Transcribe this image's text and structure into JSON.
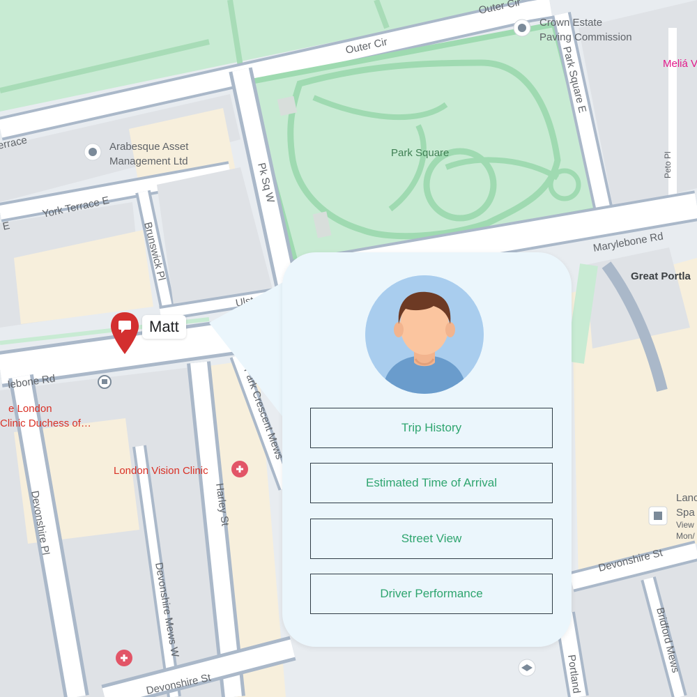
{
  "map": {
    "streets": {
      "outer_cir_top": "Outer Cir",
      "outer_cir": "Outer Cir",
      "terrace_partial": "errace",
      "york_terrace_e": "York Terrace E",
      "e_partial": "E",
      "pk_sq_w": "Pk Sq W",
      "park_square_e": "Park Square E",
      "peto_pl": "Peto Pl",
      "marylebone_rd_right": "Marylebone Rd",
      "marylebone_rd_left": "lebone Rd",
      "brunswick_pl": "Brunswick Pl",
      "ulster_pl": "Ulster Pl",
      "park_crescent_mews": "Park Crescent Mews",
      "harley_st": "Harley St",
      "devonshire_pl": "Devonshire Pl",
      "devonshire_mews_w": "Devonshire Mews W",
      "devonshire_st_bottom": "Devonshire St",
      "devonshire_st_right": "Devonshire St",
      "bridford_mews": "Bridford Mews",
      "portland_partial": "Portland"
    },
    "places": {
      "crown_estate_line1": "Crown Estate",
      "crown_estate_line2": "Paving Commission",
      "arabesque_line1": "Arabesque Asset",
      "arabesque_line2": "Management Ltd",
      "park_square": "Park Square",
      "melia_partial": "Meliá V",
      "great_portland_partial": "Great Portla",
      "london_clinic_line1": "e London",
      "london_clinic_line2": "Clinic Duchess of…",
      "london_vision_clinic": "London Vision Clinic",
      "land_partial": "Lanc",
      "spa_partial": "Spa",
      "view_partial": "View",
      "mon_partial": "Mon/"
    },
    "colors": {
      "park": "#c8ebd3",
      "road": "#aab8c9",
      "building": "#dde1e6",
      "landuse": "#f8f1e3"
    }
  },
  "marker": {
    "label": "Matt",
    "icon": "map-pin-icon",
    "color": "#d32f2f"
  },
  "popup": {
    "avatar_icon": "user-avatar-icon",
    "menu": [
      "Trip History",
      "Estimated Time of Arrival",
      "Street View",
      "Driver Performance"
    ],
    "accent_color": "#2fa56f",
    "background": "#ebf6fc"
  }
}
